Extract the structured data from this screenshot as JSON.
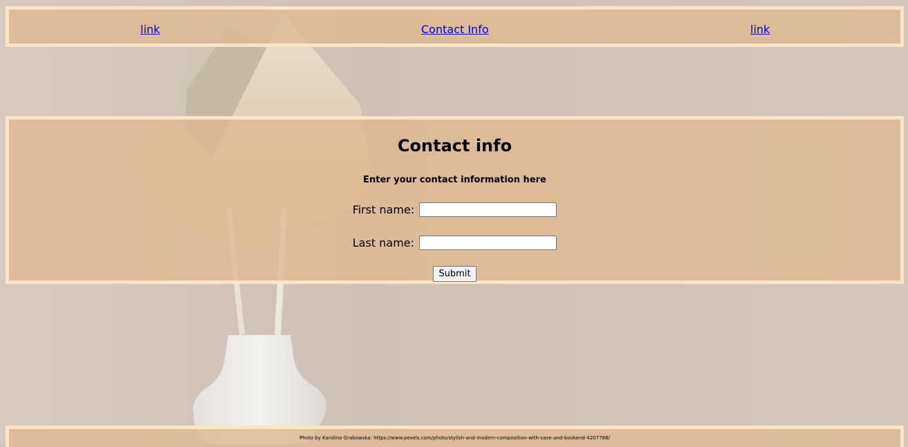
{
  "nav": {
    "links": [
      {
        "label": "link"
      },
      {
        "label": "Contact Info"
      },
      {
        "label": "link"
      }
    ]
  },
  "form": {
    "title": "Contact info",
    "subtitle": "Enter your contact information here",
    "first_name": {
      "label": "First name:",
      "value": ""
    },
    "last_name": {
      "label": "Last name:",
      "value": ""
    },
    "submit_label": "Submit"
  },
  "footer": {
    "credit": "Photo by Karolina Grabowska: https://www.pexels.com/photo/stylish-and-modern-composition-with-vase-and-bookend-4207788/"
  },
  "colors": {
    "bar_fill": "#deb98f",
    "bar_border": "#fbe5c8",
    "link": "#0000ee",
    "background": "#d2c5bb"
  }
}
